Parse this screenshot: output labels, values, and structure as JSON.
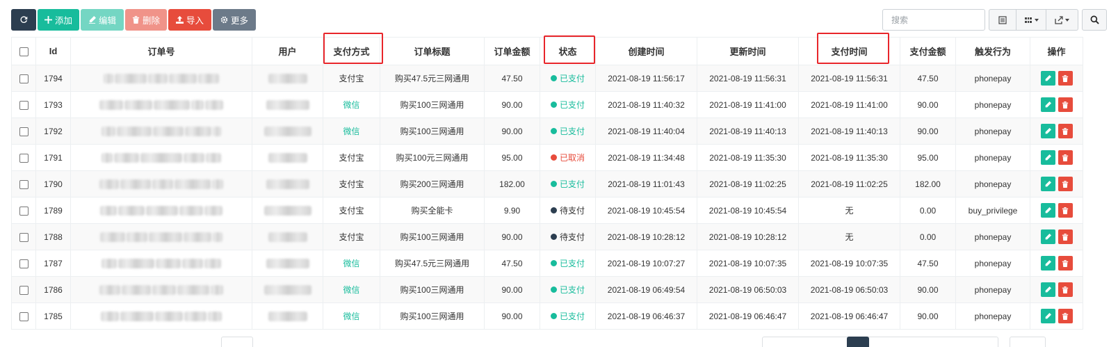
{
  "toolbar": {
    "refresh_icon": "refresh-icon",
    "add_label": "添加",
    "edit_label": "编辑",
    "delete_label": "删除",
    "import_label": "导入",
    "more_label": "更多"
  },
  "search": {
    "placeholder": "搜索"
  },
  "colors": {
    "green": "#18bc9c",
    "red": "#e74c3c",
    "dark": "#2c3e50",
    "highlight": "#e8252a"
  },
  "table": {
    "headers": [
      "Id",
      "订单号",
      "用户",
      "支付方式",
      "订单标题",
      "订单金额",
      "状态",
      "创建时间",
      "更新时间",
      "支付时间",
      "支付金额",
      "触发行为",
      "操作"
    ],
    "highlighted_columns": [
      "支付方式",
      "状态",
      "支付时间"
    ],
    "rows": [
      {
        "id": "1794",
        "pay_method": "支付宝",
        "title": "购买47.5元三网通用",
        "amount": "47.50",
        "status": "已支付",
        "status_type": "paid",
        "created": "2021-08-19 11:56:17",
        "updated": "2021-08-19 11:56:31",
        "paid_time": "2021-08-19 11:56:31",
        "paid_amount": "47.50",
        "trigger": "phonepay"
      },
      {
        "id": "1793",
        "pay_method": "微信",
        "title": "购买100三网通用",
        "amount": "90.00",
        "status": "已支付",
        "status_type": "paid",
        "created": "2021-08-19 11:40:32",
        "updated": "2021-08-19 11:41:00",
        "paid_time": "2021-08-19 11:41:00",
        "paid_amount": "90.00",
        "trigger": "phonepay"
      },
      {
        "id": "1792",
        "pay_method": "微信",
        "title": "购买100三网通用",
        "amount": "90.00",
        "status": "已支付",
        "status_type": "paid",
        "created": "2021-08-19 11:40:04",
        "updated": "2021-08-19 11:40:13",
        "paid_time": "2021-08-19 11:40:13",
        "paid_amount": "90.00",
        "trigger": "phonepay"
      },
      {
        "id": "1791",
        "pay_method": "支付宝",
        "title": "购买100元三网通用",
        "amount": "95.00",
        "status": "已取消",
        "status_type": "cancel",
        "created": "2021-08-19 11:34:48",
        "updated": "2021-08-19 11:35:30",
        "paid_time": "2021-08-19 11:35:30",
        "paid_amount": "95.00",
        "trigger": "phonepay"
      },
      {
        "id": "1790",
        "pay_method": "支付宝",
        "title": "购买200三网通用",
        "amount": "182.00",
        "status": "已支付",
        "status_type": "paid",
        "created": "2021-08-19 11:01:43",
        "updated": "2021-08-19 11:02:25",
        "paid_time": "2021-08-19 11:02:25",
        "paid_amount": "182.00",
        "trigger": "phonepay"
      },
      {
        "id": "1789",
        "pay_method": "支付宝",
        "title": "购买全能卡",
        "amount": "9.90",
        "status": "待支付",
        "status_type": "pending",
        "created": "2021-08-19 10:45:54",
        "updated": "2021-08-19 10:45:54",
        "paid_time": "无",
        "paid_amount": "0.00",
        "trigger": "buy_privilege"
      },
      {
        "id": "1788",
        "pay_method": "支付宝",
        "title": "购买100三网通用",
        "amount": "90.00",
        "status": "待支付",
        "status_type": "pending",
        "created": "2021-08-19 10:28:12",
        "updated": "2021-08-19 10:28:12",
        "paid_time": "无",
        "paid_amount": "0.00",
        "trigger": "phonepay"
      },
      {
        "id": "1787",
        "pay_method": "微信",
        "title": "购买47.5元三网通用",
        "amount": "47.50",
        "status": "已支付",
        "status_type": "paid",
        "created": "2021-08-19 10:07:27",
        "updated": "2021-08-19 10:07:35",
        "paid_time": "2021-08-19 10:07:35",
        "paid_amount": "47.50",
        "trigger": "phonepay"
      },
      {
        "id": "1786",
        "pay_method": "微信",
        "title": "购买100三网通用",
        "amount": "90.00",
        "status": "已支付",
        "status_type": "paid",
        "created": "2021-08-19 06:49:54",
        "updated": "2021-08-19 06:50:03",
        "paid_time": "2021-08-19 06:50:03",
        "paid_amount": "90.00",
        "trigger": "phonepay"
      },
      {
        "id": "1785",
        "pay_method": "微信",
        "title": "购买100三网通用",
        "amount": "90.00",
        "status": "已支付",
        "status_type": "paid",
        "created": "2021-08-19 06:46:37",
        "updated": "2021-08-19 06:46:47",
        "paid_time": "2021-08-19 06:46:47",
        "paid_amount": "90.00",
        "trigger": "phonepay"
      }
    ]
  }
}
